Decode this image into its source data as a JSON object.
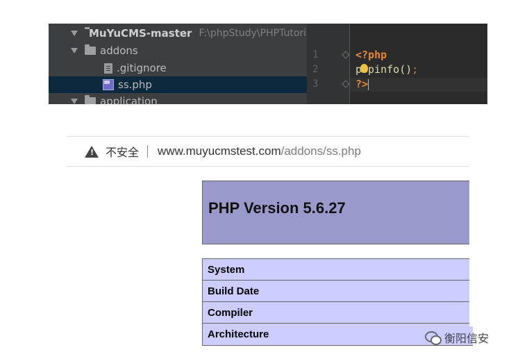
{
  "ide": {
    "tree": {
      "project_name": "MuYuCMS-master",
      "project_path": "F:\\phpStudy\\PHPTutoria",
      "items": [
        {
          "label": "addons"
        },
        {
          "label": ".gitignore"
        },
        {
          "label": "ss.php"
        },
        {
          "label": "application"
        }
      ]
    },
    "editor": {
      "line_numbers": [
        "1",
        "2",
        "3"
      ],
      "lines": [
        {
          "open_tag": "<?php"
        },
        {
          "prefix": "p",
          "rest": "pinfo",
          "parens": "()",
          "semicolon": ";"
        },
        {
          "close_tag": "?>"
        }
      ]
    }
  },
  "browser": {
    "security_text": "不安全",
    "url_host": "www.muyucmstest.com",
    "url_path": "/addons/ss.php"
  },
  "phpinfo": {
    "title": "PHP Version 5.6.27",
    "rows": [
      {
        "label": "System"
      },
      {
        "label": "Build Date"
      },
      {
        "label": "Compiler"
      },
      {
        "label": "Architecture"
      }
    ]
  },
  "watermark": {
    "text": "衡阳信安"
  },
  "colors": {
    "ide_bg": "#3c3f41",
    "editor_bg": "#2b2b2b",
    "php_tag": "#e8872f",
    "php_header": "#9999cc",
    "php_row": "#ccccff",
    "selection": "#0d293e"
  }
}
